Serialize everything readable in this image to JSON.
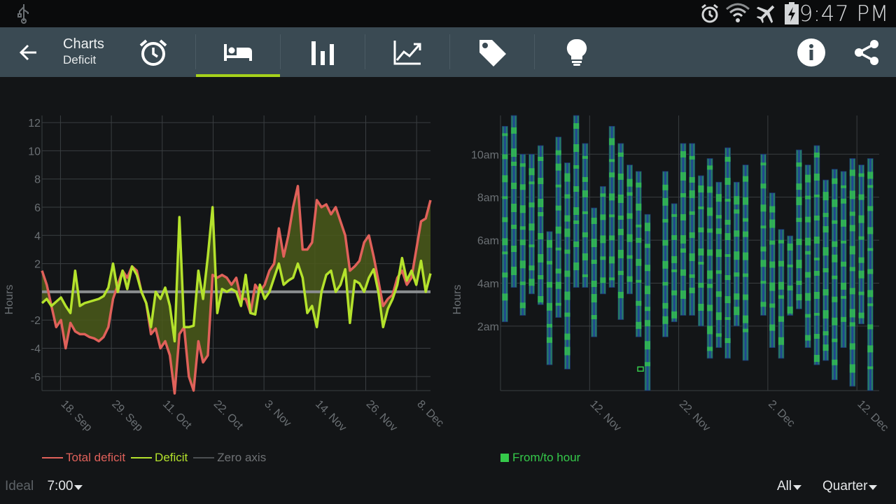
{
  "status_bar": {
    "time": "9:47 PM",
    "icons": [
      "usb-icon",
      "alarm-icon",
      "wifi-icon",
      "airplane-mode-icon",
      "battery-charging-icon"
    ]
  },
  "action_bar": {
    "title": "Charts",
    "subtitle": "Deficit",
    "tabs": [
      {
        "name": "alarm-clock-icon",
        "active": false
      },
      {
        "name": "bed-icon",
        "active": true
      },
      {
        "name": "bar-chart-icon",
        "active": false
      },
      {
        "name": "trend-line-icon",
        "active": false
      },
      {
        "name": "tag-icon",
        "active": false
      },
      {
        "name": "lightbulb-icon",
        "active": false
      }
    ],
    "right_icons": [
      "info-icon",
      "share-icon"
    ]
  },
  "colors": {
    "accent": "#a6d21b",
    "total_deficit": "#e0615a",
    "deficit": "#b4e22c",
    "zero_axis": "#8a8d8f",
    "fill": "#4b5a1a",
    "from_to_hour": "#35c94a",
    "bar_core": "#1e3a9a"
  },
  "chart_data": [
    {
      "type": "line",
      "ylabel": "Hours",
      "ylim": [
        -7,
        12.5
      ],
      "yticks": [
        "12",
        "10",
        "8",
        "6",
        "4",
        "2",
        "-2",
        "-4",
        "-6"
      ],
      "ytick_values": [
        12,
        10,
        8,
        6,
        4,
        2,
        -2,
        -4,
        -6
      ],
      "xticks": [
        "18. Sep",
        "29. Sep",
        "11. Oct",
        "22. Oct",
        "3. Nov",
        "14. Nov",
        "26. Nov",
        "8. Dec"
      ],
      "xlim": [
        0,
        84
      ],
      "xtick_values": [
        4,
        15,
        26,
        37,
        48,
        59,
        70,
        81
      ],
      "series": [
        {
          "name": "Total deficit",
          "values": [
            1.5,
            0.5,
            -1,
            -2.5,
            -2,
            -4,
            -2.2,
            -2.8,
            -3,
            -3,
            -3.2,
            -3.3,
            -3.5,
            -3.2,
            -2.5,
            -0.5,
            0.5,
            1.5,
            1,
            1.8,
            1.5,
            0,
            -0.8,
            -3,
            -2.6,
            -4,
            -3.5,
            -4.5,
            -7.2,
            -3,
            -2.5,
            -6,
            -7,
            -3.5,
            -5,
            -4.5,
            1.2,
            1,
            1.2,
            1,
            0.5,
            1,
            -0.5,
            -0.5,
            -1.5,
            0.5,
            0,
            0.5,
            1.5,
            2,
            4.5,
            2.5,
            4,
            6,
            7.5,
            3,
            3,
            3.5,
            6.5,
            6,
            6.2,
            5.5,
            6,
            5,
            4,
            1.5,
            1.8,
            2.2,
            3.5,
            4,
            2.5,
            0.8,
            -1,
            -0.5,
            -0.2,
            1,
            1.5,
            0.5,
            1,
            3,
            5,
            5.2,
            6.5
          ]
        },
        {
          "name": "Deficit",
          "values": [
            -0.8,
            -0.5,
            -1,
            -0.7,
            -0.4,
            -1,
            -1.5,
            1.5,
            -1,
            -0.8,
            -0.7,
            -0.6,
            -0.5,
            -0.3,
            0.3,
            2,
            0,
            1.5,
            0.2,
            1.8,
            1.2,
            0,
            -0.8,
            -2.5,
            0,
            -0.5,
            0.3,
            -1,
            -3.5,
            5.3,
            -2.5,
            -2.5,
            -2.4,
            1.5,
            -0.5,
            2.5,
            6,
            -1.5,
            0.2,
            0,
            0.2,
            0,
            -1,
            1.2,
            -1.5,
            -1.6,
            0.5,
            -0.5,
            0,
            1,
            2,
            0.5,
            0.8,
            1,
            2,
            1,
            -1.5,
            -1,
            -2.5,
            0,
            1.2,
            1.5,
            0,
            0.5,
            1.6,
            -2.2,
            0.8,
            0.6,
            0,
            1,
            1.6,
            0,
            -2.5,
            -1.2,
            -0.5,
            0.5,
            2.4,
            0.8,
            1.5,
            0.5,
            2.2,
            0,
            1.3
          ]
        },
        {
          "name": "Zero axis",
          "values": [
            0,
            0
          ]
        }
      ],
      "legend": "bottom-left"
    },
    {
      "type": "bar",
      "ylabel": "Hours",
      "yticks": [
        "10am",
        "8am",
        "6am",
        "4am",
        "2am"
      ],
      "ytick_values": [
        10,
        8,
        6,
        4,
        2
      ],
      "ylim": [
        -1,
        11.8
      ],
      "xticks": [
        "12. Nov",
        "22. Nov",
        "2. Dec",
        "12. Dec"
      ],
      "xtick_values": [
        10,
        20,
        30,
        40
      ],
      "xlim": [
        0,
        42.5
      ],
      "series_name": "From/to hour",
      "bars": [
        {
          "x": 0.5,
          "from": 2.2,
          "to": 11.3
        },
        {
          "x": 1.5,
          "from": 3.8,
          "to": 11.8
        },
        {
          "x": 2.5,
          "from": 2.5,
          "to": 10
        },
        {
          "x": 3.5,
          "from": 3.5,
          "to": 10
        },
        {
          "x": 4.5,
          "from": 3,
          "to": 10.4
        },
        {
          "x": 5.5,
          "from": 0.2,
          "to": 6.4
        },
        {
          "x": 6.5,
          "from": 2.4,
          "to": 10.8
        },
        {
          "x": 7.5,
          "from": 0,
          "to": 9.6
        },
        {
          "x": 8.5,
          "from": 3.8,
          "to": 11.8
        },
        {
          "x": 9.5,
          "from": 3.8,
          "to": 10.5
        },
        {
          "x": 10.5,
          "from": 1.5,
          "to": 7.5
        },
        {
          "x": 11.5,
          "from": 3.5,
          "to": 8.5
        },
        {
          "x": 12.5,
          "from": 3.8,
          "to": 11.3
        },
        {
          "x": 13.5,
          "from": 2.3,
          "to": 10.5
        },
        {
          "x": 14.5,
          "from": 3.5,
          "to": 9.5
        },
        {
          "x": 15.5,
          "from": 1.5,
          "to": 9.2
        },
        {
          "x": 16.5,
          "from": -1,
          "to": 7.2
        },
        {
          "x": 18.5,
          "from": 1.5,
          "to": 9.2
        },
        {
          "x": 19.5,
          "from": 2.2,
          "to": 7.7
        },
        {
          "x": 20.5,
          "from": 2.5,
          "to": 10.5
        },
        {
          "x": 21.5,
          "from": 2.5,
          "to": 10.5
        },
        {
          "x": 22.5,
          "from": 2,
          "to": 9
        },
        {
          "x": 23.5,
          "from": 0.5,
          "to": 9.8
        },
        {
          "x": 24.5,
          "from": 1,
          "to": 8.7
        },
        {
          "x": 25.5,
          "from": 0.5,
          "to": 10.3
        },
        {
          "x": 26.5,
          "from": 2,
          "to": 8.7
        },
        {
          "x": 27.5,
          "from": 0.4,
          "to": 9.5
        },
        {
          "x": 29.5,
          "from": 2.5,
          "to": 10
        },
        {
          "x": 30.5,
          "from": 1,
          "to": 8.2
        },
        {
          "x": 31.5,
          "from": 0.5,
          "to": 6.5
        },
        {
          "x": 32.5,
          "from": 2.5,
          "to": 6.2
        },
        {
          "x": 33.5,
          "from": 2.8,
          "to": 10.2
        },
        {
          "x": 34.5,
          "from": 1,
          "to": 9.5
        },
        {
          "x": 35.5,
          "from": 0.2,
          "to": 10.4
        },
        {
          "x": 36.5,
          "from": 0.4,
          "to": 8.8
        },
        {
          "x": 37.5,
          "from": -0.5,
          "to": 9.3
        },
        {
          "x": 38.5,
          "from": 1,
          "to": 9.2
        },
        {
          "x": 39.5,
          "from": -0.8,
          "to": 9.8
        },
        {
          "x": 40.5,
          "from": 2.1,
          "to": 9.5
        },
        {
          "x": 41.5,
          "from": -1,
          "to": 9.8
        }
      ],
      "legend": "bottom-left"
    }
  ],
  "legend_left": {
    "items": [
      {
        "label": "Total deficit",
        "color": "#e0615a"
      },
      {
        "label": "Deficit",
        "color": "#b4e22c"
      },
      {
        "label": "Zero axis",
        "color": "#6f7275"
      }
    ]
  },
  "legend_right": {
    "label": "From/to hour",
    "color": "#35c94a"
  },
  "footer": {
    "ideal_label": "Ideal",
    "ideal_value": "7:00",
    "filter_value": "All",
    "period_value": "Quarter"
  }
}
